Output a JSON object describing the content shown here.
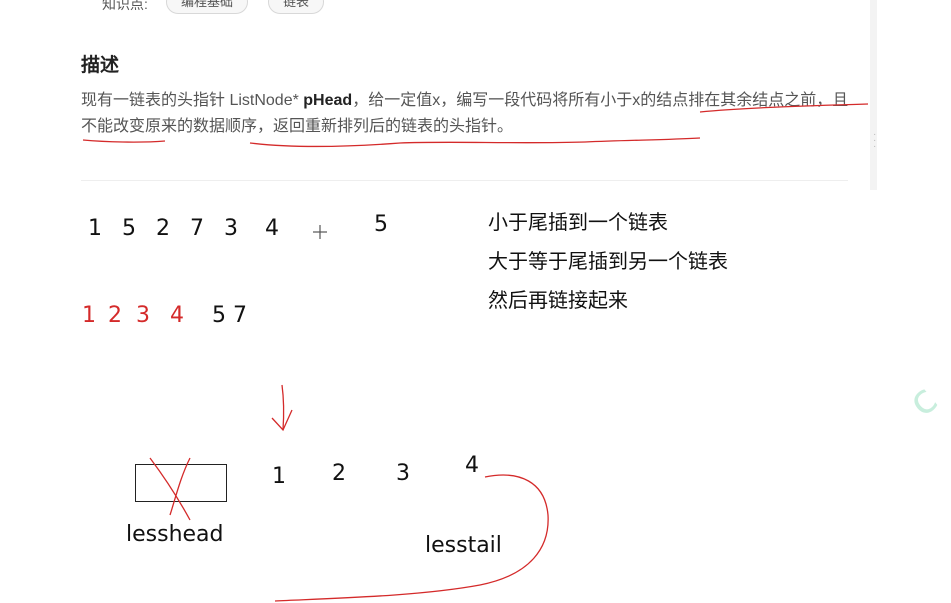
{
  "header": {
    "knowledge_label": "知识点:",
    "tags": [
      "编程基础",
      "链表"
    ]
  },
  "description": {
    "heading": "描述",
    "text_part1": "现有一链表的头指针 ListNode* ",
    "text_bold": "pHead",
    "text_part2": "，给一定值x，编写一段代码将所有小于x的结点排在其余结点之前，且不能改变原来的数据顺序，返回重新排列后的链表的头指针。"
  },
  "annotations": {
    "original_sequence": [
      "1",
      "5",
      "2",
      "7",
      "3",
      "4"
    ],
    "pivot_value": "5",
    "result_less": [
      "1",
      "2",
      "3",
      "4"
    ],
    "result_rest": "5 7",
    "notes": [
      "小于尾插到一个链表",
      "大于等于尾插到另一个链表",
      "然后再链接起来"
    ],
    "list_nodes": [
      "1",
      "2",
      "3",
      "4"
    ],
    "lesshead_label": "lesshead",
    "lesstail_label": "lesstail"
  },
  "colors": {
    "ink": "#111111",
    "red_ink": "#d42a2a",
    "body_text": "#555555"
  }
}
